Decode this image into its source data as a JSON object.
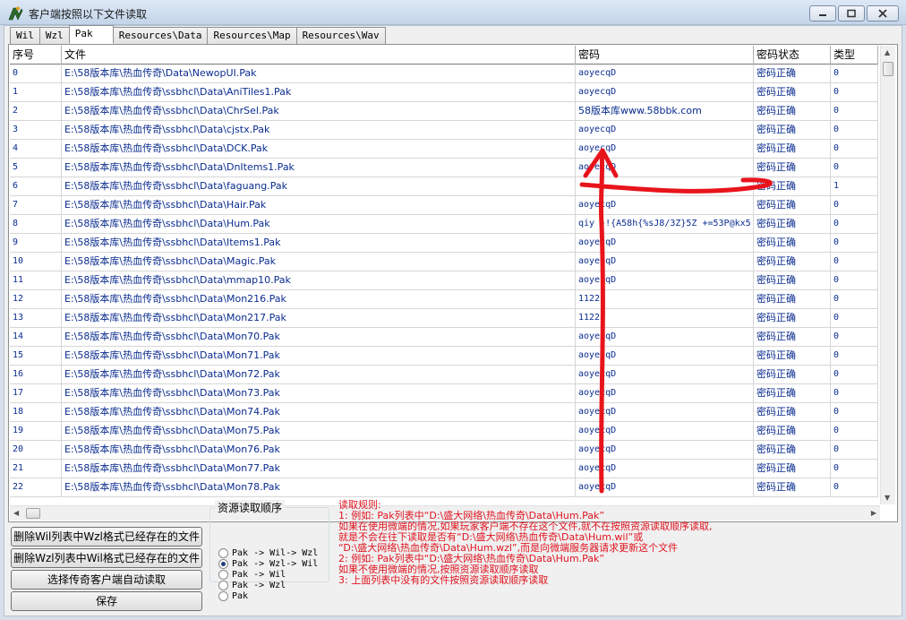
{
  "window": {
    "title": "客户端按照以下文件读取"
  },
  "tabs": [
    {
      "label": "Wil",
      "active": false
    },
    {
      "label": "Wzl",
      "active": false
    },
    {
      "label": "Pak",
      "active": true
    },
    {
      "label": "Resources\\Data",
      "active": false
    },
    {
      "label": "Resources\\Map",
      "active": false
    },
    {
      "label": "Resources\\Wav",
      "active": false
    }
  ],
  "grid": {
    "headers": [
      "序号",
      "文件",
      "密码",
      "密码状态",
      "类型"
    ],
    "rows": [
      [
        "0",
        "E:\\58版本库\\热血传奇\\Data\\NewopUI.Pak",
        "aoyecqD",
        "密码正确",
        "0"
      ],
      [
        "1",
        "E:\\58版本库\\热血传奇\\ssbhcl\\Data\\AniTiles1.Pak",
        "aoyecqD",
        "密码正确",
        "0"
      ],
      [
        "2",
        "E:\\58版本库\\热血传奇\\ssbhcl\\Data\\ChrSel.Pak",
        "58版本库www.58bbk.com",
        "密码正确",
        "0"
      ],
      [
        "3",
        "E:\\58版本库\\热血传奇\\ssbhcl\\Data\\cjstx.Pak",
        "aoyecqD",
        "密码正确",
        "0"
      ],
      [
        "4",
        "E:\\58版本库\\热血传奇\\ssbhcl\\Data\\DCK.Pak",
        "aoyecqD",
        "密码正确",
        "0"
      ],
      [
        "5",
        "E:\\58版本库\\热血传奇\\ssbhcl\\Data\\DnItems1.Pak",
        "aoyecqD",
        "密码正确",
        "0"
      ],
      [
        "6",
        "E:\\58版本库\\热血传奇\\ssbhcl\\Data\\faguang.Pak",
        "",
        "密码正确",
        "1"
      ],
      [
        "7",
        "E:\\58版本库\\热血传奇\\ssbhcl\\Data\\Hair.Pak",
        "aoyecqD",
        "密码正确",
        "0"
      ],
      [
        "8",
        "E:\\58版本库\\热血传奇\\ssbhcl\\Data\\Hum.Pak",
        "qiy  }!{A58h{%sJ8/3Z}5Z +=53P@kx5",
        "密码正确",
        "0"
      ],
      [
        "9",
        "E:\\58版本库\\热血传奇\\ssbhcl\\Data\\Items1.Pak",
        "aoyecqD",
        "密码正确",
        "0"
      ],
      [
        "10",
        "E:\\58版本库\\热血传奇\\ssbhcl\\Data\\Magic.Pak",
        "aoyecqD",
        "密码正确",
        "0"
      ],
      [
        "11",
        "E:\\58版本库\\热血传奇\\ssbhcl\\Data\\mmap10.Pak",
        "aoyecqD",
        "密码正确",
        "0"
      ],
      [
        "12",
        "E:\\58版本库\\热血传奇\\ssbhcl\\Data\\Mon216.Pak",
        "11223",
        "密码正确",
        "0"
      ],
      [
        "13",
        "E:\\58版本库\\热血传奇\\ssbhcl\\Data\\Mon217.Pak",
        "11223",
        "密码正确",
        "0"
      ],
      [
        "14",
        "E:\\58版本库\\热血传奇\\ssbhcl\\Data\\Mon70.Pak",
        "aoyecqD",
        "密码正确",
        "0"
      ],
      [
        "15",
        "E:\\58版本库\\热血传奇\\ssbhcl\\Data\\Mon71.Pak",
        "aoyecqD",
        "密码正确",
        "0"
      ],
      [
        "16",
        "E:\\58版本库\\热血传奇\\ssbhcl\\Data\\Mon72.Pak",
        "aoyecqD",
        "密码正确",
        "0"
      ],
      [
        "17",
        "E:\\58版本库\\热血传奇\\ssbhcl\\Data\\Mon73.Pak",
        "aoyecqD",
        "密码正确",
        "0"
      ],
      [
        "18",
        "E:\\58版本库\\热血传奇\\ssbhcl\\Data\\Mon74.Pak",
        "aoyecqD",
        "密码正确",
        "0"
      ],
      [
        "19",
        "E:\\58版本库\\热血传奇\\ssbhcl\\Data\\Mon75.Pak",
        "aoyecqD",
        "密码正确",
        "0"
      ],
      [
        "20",
        "E:\\58版本库\\热血传奇\\ssbhcl\\Data\\Mon76.Pak",
        "aoyecqD",
        "密码正确",
        "0"
      ],
      [
        "21",
        "E:\\58版本库\\热血传奇\\ssbhcl\\Data\\Mon77.Pak",
        "aoyecqD",
        "密码正确",
        "0"
      ],
      [
        "22",
        "E:\\58版本库\\热血传奇\\ssbhcl\\Data\\Mon78.Pak",
        "aoyecqD",
        "密码正确",
        "0"
      ]
    ]
  },
  "buttons": {
    "delete_wil": "删除Wil列表中Wzl格式已经存在的文件",
    "delete_wzl": "删除Wzl列表中Wil格式已经存在的文件",
    "auto_read": "选择传奇客户端自动读取",
    "save": "保存"
  },
  "resource_order": {
    "title": "资源读取顺序",
    "options": [
      {
        "label": "Pak -> Wil-> Wzl",
        "selected": false
      },
      {
        "label": "Pak -> Wzl-> Wil",
        "selected": true
      },
      {
        "label": "Pak -> Wil",
        "selected": false
      },
      {
        "label": "Pak -> Wzl",
        "selected": false
      },
      {
        "label": "Pak",
        "selected": false
      }
    ]
  },
  "rules": {
    "lines": [
      "读取规则:",
      "1: 例如: Pak列表中“D:\\盛大网络\\热血传奇\\Data\\Hum.Pak”",
      "     如果在使用微端的情况,如果玩家客户端不存在这个文件,就不在按照资源读取顺序读取,",
      "     就是不会在往下读取是否有“D:\\盛大网络\\热血传奇\\Data\\Hum.wil”或",
      "    “D:\\盛大网络\\热血传奇\\Data\\Hum.wzl”,而是向微端服务器请求更新这个文件",
      "2: 例如: Pak列表中“D:\\盛大网络\\热血传奇\\Data\\Hum.Pak”",
      "     如果不使用微端的情况,按照资源读取顺序读取",
      "3: 上面列表中没有的文件按照资源读取顺序读取"
    ]
  },
  "colors": {
    "cell_text": "#0a2c8f",
    "rules_text": "#e0141f",
    "annotation": "#e8141c"
  }
}
